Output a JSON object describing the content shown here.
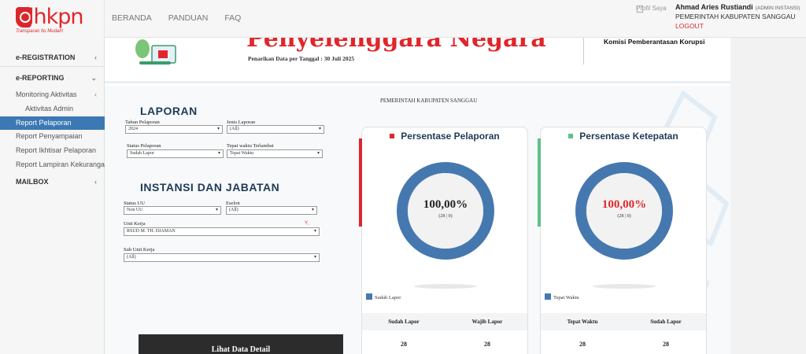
{
  "app": {
    "logo": "lhkpn",
    "tagline": "Transparan Itu Mudah!"
  },
  "nav": [
    "BERANDA",
    "PANDUAN",
    "FAQ"
  ],
  "user": {
    "avatar_alt": "Profil Saya",
    "name": "Ahmad Aries Rustiandi",
    "role": "(ADMIN INSTANSI)",
    "org": "PEMERINTAH KABUPATEN SANGGAU",
    "logout": "LOGOUT"
  },
  "sidebar": {
    "registration": "e-REGISTRATION",
    "reporting": "e-REPORTING",
    "monitoring": "Monitoring Aktivitas",
    "aktivitas_admin": "Aktivitas Admin",
    "report_pelaporan": "Report Pelaporan",
    "report_penyampaian": "Report Penyampaian",
    "report_ikhtisar": "Report Ikhtisar Pelaporan",
    "report_lampiran": "Report Lampiran Kekurangan",
    "mailbox": "MAILBOX",
    "chevron_right": "‹",
    "chevron_down": "⌄"
  },
  "banner": {
    "title": "Penyelenggara Negara",
    "date_text": "Penarikan Data per Tanggal : 30 Juli 2025",
    "org": "Komisi Pemberantasan Korupsi"
  },
  "report": {
    "gov_title": "PEMERINTAH KABUPATEN SANGGAU",
    "laporan_title": "LAPORAN",
    "tahun_label": "Tahun Pelaporan",
    "tahun_value": "2024",
    "jenis_label": "Jenis Laporan",
    "jenis_value": "(All)",
    "status_label": "Status Pelaporan",
    "status_value": "Sudah Lapor",
    "tepat_label": "Tepat waktu Terlambat",
    "tepat_value": "Tepat Waktu",
    "instansi_title": "INSTANSI DAN JABATAN",
    "uu_label": "Status UU",
    "uu_value": "Non UU",
    "eselon_label": "Eselon",
    "eselon_value": "(All)",
    "unit_label": "Unit Kerja",
    "unit_value": "RSUD M. TH. DJAMAN",
    "unit_filter_mark": "Y‚",
    "sub_label": "Sub Unit Kerja",
    "sub_value": "(All)",
    "detail_button": "Lihat Data Detail",
    "dropdown_arrow": "▾"
  },
  "cards": [
    {
      "title": "Persentase Pelaporan",
      "accent": "#e0262b",
      "percent": "100,00%",
      "sub": "(28 | 0)",
      "percent_color": "#222222",
      "ring_color": "#4678b0",
      "legend": "Sudah Lapor",
      "col1": "Sudah Lapor",
      "col2": "Wajib Lapor",
      "val1": "28",
      "val2": "28"
    },
    {
      "title": "Persentase Ketepatan",
      "accent": "#5cc08a",
      "percent": "100,00%",
      "sub": "(28 | 0)",
      "percent_color": "#e0262b",
      "ring_color": "#4678b0",
      "legend": "Tepat Waktu",
      "col1": "Tepat Waktu",
      "col2": "Sudah Lapor",
      "val1": "28",
      "val2": "28"
    }
  ]
}
